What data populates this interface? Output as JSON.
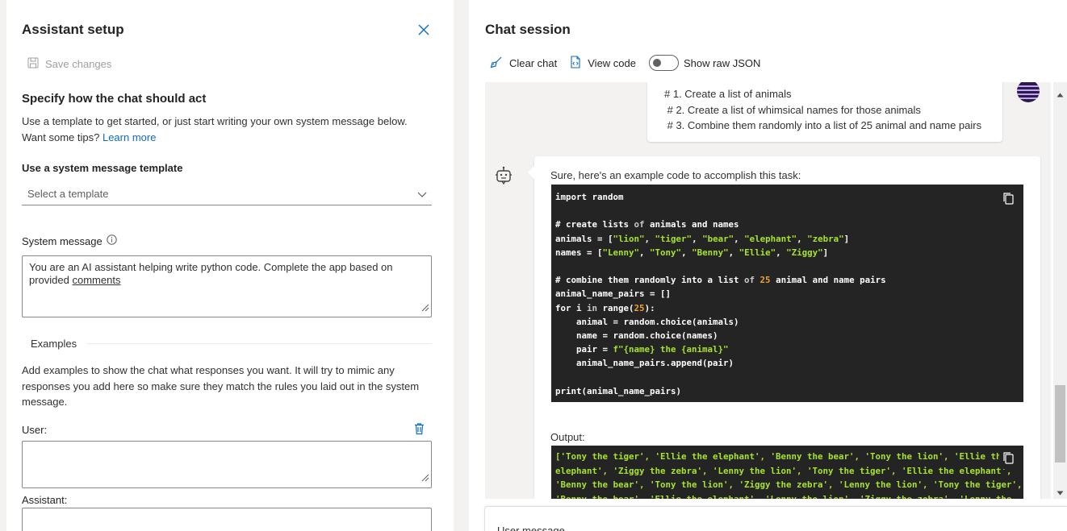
{
  "setup": {
    "title": "Assistant setup",
    "save_label": "Save changes",
    "heading": "Specify how the chat should act",
    "desc_line1": "Use a template to get started, or just start writing your own system message below.",
    "desc_line2": "Want some tips?",
    "learn_more": "Learn more",
    "template_label": "Use a system message template",
    "template_placeholder": "Select a template",
    "system_message_label": "System message",
    "system_message_value_a": "You are an AI assistant helping write python code. Complete the app based on provided",
    "system_message_value_b": "comments",
    "examples_label": "Examples",
    "examples_desc": "Add examples to show the chat what responses you want. It will try to mimic any responses you add here so make sure they match the rules you laid out in the system message.",
    "user_label": "User:",
    "assistant_label": "Assistant:"
  },
  "chat": {
    "title": "Chat session",
    "toolbar": {
      "clear_chat": "Clear chat",
      "view_code": "View code",
      "show_raw_json": "Show raw JSON",
      "show_raw_json_on": false
    },
    "user_message_lines": [
      "# 1. Create a list of animals",
      " # 2. Create a list of whimsical names for those animals",
      " # 3. Combine them randomly into a list of 25 animal and name pairs"
    ],
    "assistant_intro": "Sure, here's an example code to accomplish this task:",
    "code_lines": [
      "import random",
      "",
      "# create lists of animals and names",
      "animals = [\"lion\", \"tiger\", \"bear\", \"elephant\", \"zebra\"]",
      "names = [\"Lenny\", \"Tony\", \"Benny\", \"Ellie\", \"Ziggy\"]",
      "",
      "# combine them randomly into a list of 25 animal and name pairs",
      "animal_name_pairs = []",
      "for i in range(25):",
      "    animal = random.choice(animals)",
      "    name = random.choice(names)",
      "    pair = f\"{name} the {animal}\"",
      "    animal_name_pairs.append(pair)",
      "",
      "print(animal_name_pairs)"
    ],
    "output_label": "Output:",
    "output_lines": [
      "['Tony the tiger', 'Ellie the elephant', 'Benny the bear', 'Tony the lion', 'Ellie the",
      "elephant', 'Ziggy the zebra', 'Lenny the lion', 'Tony the tiger', 'Ellie the elephant',",
      "'Benny the bear', 'Tony the lion', 'Ziggy the zebra', 'Lenny the lion', 'Tony the tiger',",
      "'Benny the bear', 'Ellie the elephant', 'Lenny the lion', 'Ziggy the zebra', 'Lenny the"
    ],
    "input_label": "User message"
  },
  "colors": {
    "accent": "#0f6cbd",
    "code_bg": "#242424",
    "code_string": "#a6e22e",
    "code_number": "#f0a030"
  }
}
